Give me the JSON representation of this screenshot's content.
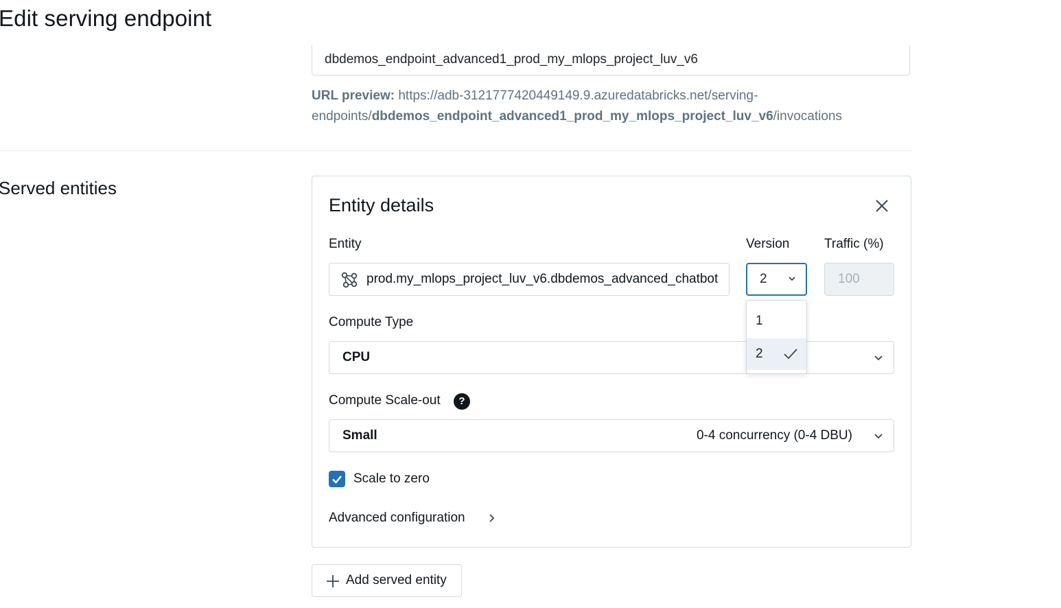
{
  "page": {
    "title": "Edit serving endpoint"
  },
  "endpoint": {
    "name_value": "dbdemos_endpoint_advanced1_prod_my_mlops_project_luv_v6",
    "url_preview_label": "URL preview:",
    "url_prefix": " https://adb-3121777420449149.9.azuredatabricks.net/serving-endpoints/",
    "url_name": "dbdemos_endpoint_advanced1_prod_my_mlops_project_luv_v6",
    "url_suffix": "/invocations"
  },
  "served_entities": {
    "section_title": "Served entities",
    "card_title": "Entity details",
    "entity_label": "Entity",
    "entity_value": "prod.my_mlops_project_luv_v6.dbdemos_advanced_chatbot",
    "version_label": "Version",
    "version_value": "2",
    "version_options": [
      "1",
      "2"
    ],
    "traffic_label": "Traffic (%)",
    "traffic_value": "100",
    "compute_type_label": "Compute Type",
    "compute_type_value": "CPU",
    "scale_out_label": "Compute Scale-out",
    "scale_out_value": "Small",
    "scale_out_desc": "0-4 concurrency (0-4 DBU)",
    "scale_to_zero_label": "Scale to zero",
    "scale_to_zero_checked": true,
    "advanced_config_label": "Advanced configuration",
    "add_button_label": "Add served entity",
    "help_glyph": "?"
  },
  "icons": {
    "entity": "model-graph-icon",
    "close": "close-icon",
    "chevron": "chevron-down-icon",
    "check": "checkmark-icon",
    "help": "question-circle-icon",
    "plus": "plus-icon",
    "chevron_right": "chevron-right-icon"
  },
  "colors": {
    "accent": "#2272b4",
    "muted_text": "#5f7281",
    "border": "#d1d9e1",
    "disabled_bg": "#eef1f4"
  }
}
